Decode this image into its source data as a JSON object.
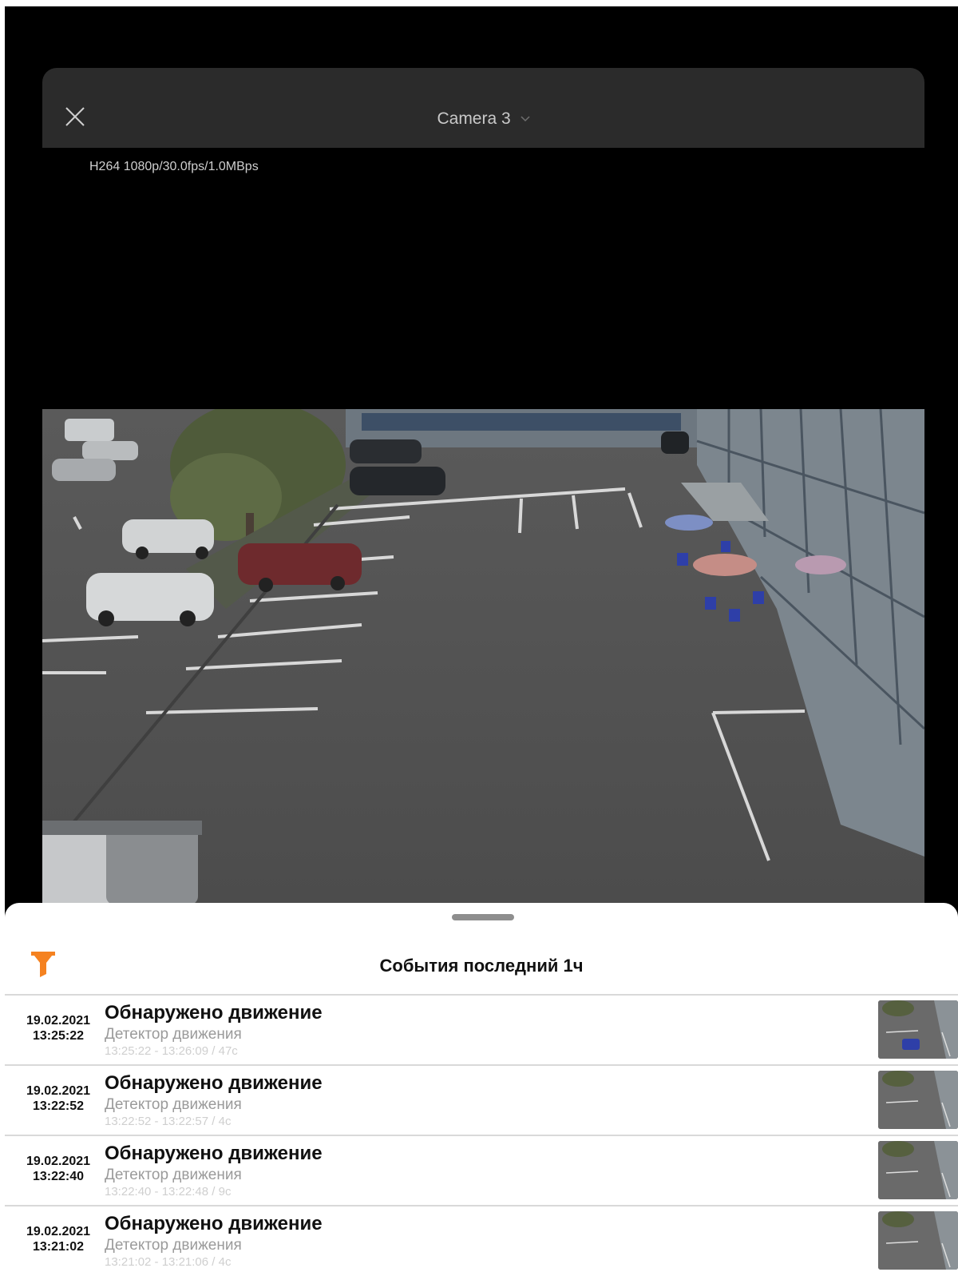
{
  "header": {
    "camera_name": "Camera 3",
    "stream_info": "H264 1080p/30.0fps/1.0MBps"
  },
  "colors": {
    "accent": "#F58220",
    "topbar": "#2B2B2B"
  },
  "icons": {
    "close": "close-icon",
    "dropdown": "chevron-down-icon",
    "filter": "filter-icon"
  },
  "sheet": {
    "title": "События последний 1ч",
    "events": [
      {
        "date": "19.02.2021",
        "time": "13:25:22",
        "title": "Обнаружено движение",
        "detector": "Детектор движения",
        "range": "13:25:22 - 13:26:09 / 47c"
      },
      {
        "date": "19.02.2021",
        "time": "13:22:52",
        "title": "Обнаружено движение",
        "detector": "Детектор движения",
        "range": "13:22:52 - 13:22:57 / 4c"
      },
      {
        "date": "19.02.2021",
        "time": "13:22:40",
        "title": "Обнаружено движение",
        "detector": "Детектор движения",
        "range": "13:22:40 - 13:22:48 / 9c"
      },
      {
        "date": "19.02.2021",
        "time": "13:21:02",
        "title": "Обнаружено движение",
        "detector": "Детектор движения",
        "range": "13:21:02 - 13:21:06 / 4c"
      }
    ]
  }
}
